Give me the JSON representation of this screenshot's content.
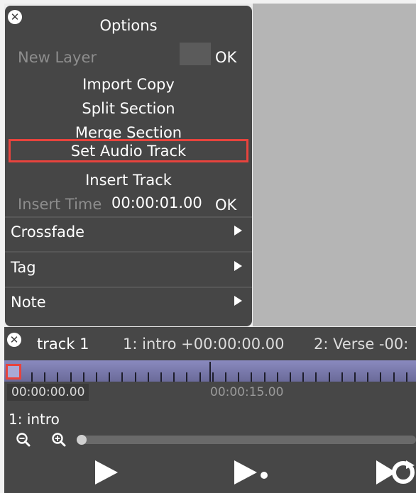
{
  "options": {
    "title": "Options",
    "new_layer_label": "New Layer",
    "new_layer_ok": "OK",
    "items": {
      "import_copy": "Import Copy",
      "split_section": "Split Section",
      "merge_section": "Merge Section",
      "set_audio_track": "Set Audio Track",
      "insert_track": "Insert Track"
    },
    "insert_time_label": "Insert Time",
    "insert_time_value": "00:00:01.00",
    "insert_time_ok": "OK",
    "submenus": {
      "crossfade": "Crossfade",
      "tag": "Tag",
      "note": "Note"
    }
  },
  "timeline": {
    "track_name": "track 1",
    "sections": [
      "1: intro +00:00:00.00",
      "2: Verse -00:"
    ],
    "current_time": "00:00:00.00",
    "time_mark": "00:00:15.00",
    "selected_section": "1: intro"
  },
  "colors": {
    "panel": "#464646",
    "highlight": "#e8433d",
    "ruler": "#7b7bb0",
    "stage": "#b5b5b5"
  },
  "icons": [
    "close-icon",
    "submenu-arrow-icon",
    "zoom-out-icon",
    "zoom-in-icon",
    "play-icon",
    "play-selection-icon",
    "loop-icon"
  ]
}
